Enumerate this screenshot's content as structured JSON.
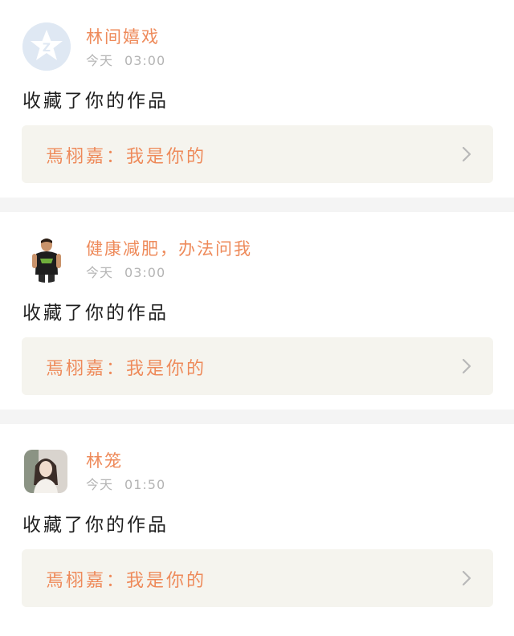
{
  "notifications": [
    {
      "avatar_icon": "qq-logo-icon",
      "username": "林间嬉戏",
      "time_label": "今天",
      "time_value": "03:00",
      "action": "收藏了你的作品",
      "work_text": "焉栩嘉：我是你的",
      "arrow_icon": "chevron-right-icon"
    },
    {
      "avatar_icon": "fitness-man-avatar",
      "username": "健康减肥，办法问我",
      "time_label": "今天",
      "time_value": "03:00",
      "action": "收藏了你的作品",
      "work_text": "焉栩嘉：我是你的",
      "arrow_icon": "chevron-right-icon"
    },
    {
      "avatar_icon": "woman-portrait-avatar",
      "username": "林笼",
      "time_label": "今天",
      "time_value": "01:50",
      "action": "收藏了你的作品",
      "work_text": "焉栩嘉：我是你的",
      "arrow_icon": "chevron-right-icon"
    }
  ],
  "colors": {
    "accent": "#ee8a5a",
    "time_gray": "#b4b4b4",
    "box_bg": "#f5f4ee",
    "divider": "#f4f4f4"
  }
}
